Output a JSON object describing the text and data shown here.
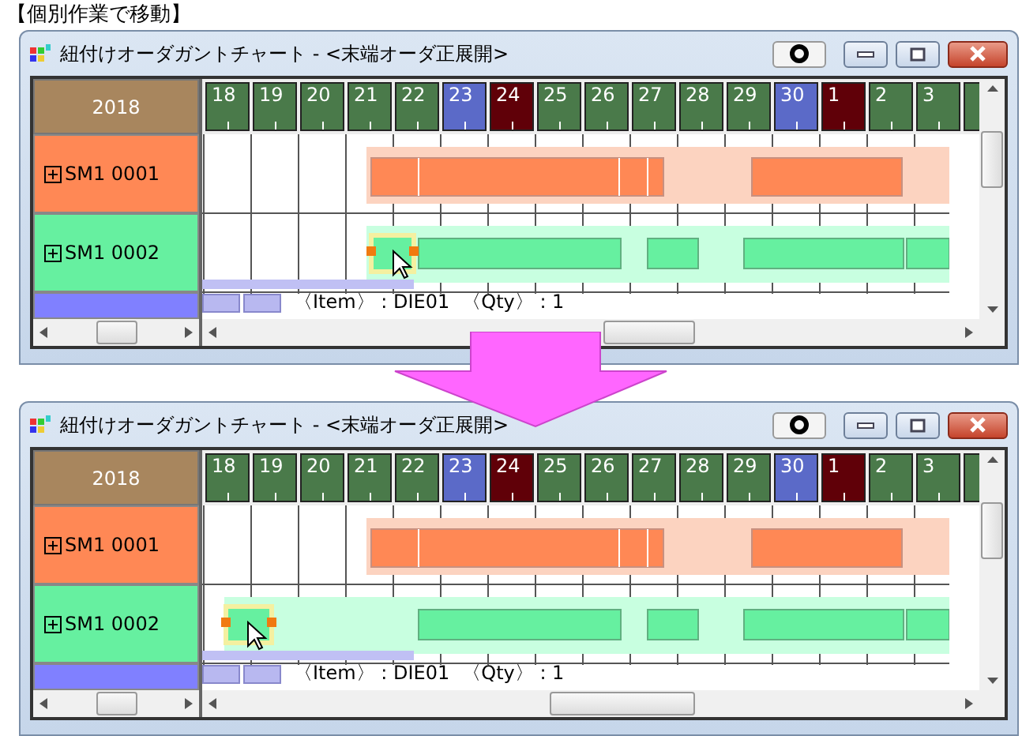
{
  "caption": "【個別作業で移動】",
  "windows": [
    {
      "kind": "before",
      "title": "紐付けオーダガントチャート - <末端オーダ正展開>",
      "year": "2018",
      "days": [
        {
          "label": "18",
          "kind": "weekday"
        },
        {
          "label": "19",
          "kind": "weekday"
        },
        {
          "label": "20",
          "kind": "weekday"
        },
        {
          "label": "21",
          "kind": "weekday"
        },
        {
          "label": "22",
          "kind": "weekday"
        },
        {
          "label": "23",
          "kind": "saturday"
        },
        {
          "label": "24",
          "kind": "sunday"
        },
        {
          "label": "25",
          "kind": "weekday"
        },
        {
          "label": "26",
          "kind": "weekday"
        },
        {
          "label": "27",
          "kind": "weekday"
        },
        {
          "label": "28",
          "kind": "weekday"
        },
        {
          "label": "29",
          "kind": "weekday"
        },
        {
          "label": "30",
          "kind": "saturday"
        },
        {
          "label": "1",
          "kind": "sunday"
        },
        {
          "label": "2",
          "kind": "weekday"
        },
        {
          "label": "3",
          "kind": "weekday"
        }
      ],
      "rows": [
        {
          "label": "SM1 0001",
          "color": "#ff8855"
        },
        {
          "label": "SM1 0002",
          "color": "#66f0a0"
        }
      ],
      "tooltip": [
        "〈Item〉 : DIE01",
        "〈Qty〉 : 1"
      ]
    },
    {
      "kind": "after",
      "title": "紐付けオーダガントチャート - <末端オーダ正展開>",
      "year": "2018",
      "days": [
        {
          "label": "18",
          "kind": "weekday"
        },
        {
          "label": "19",
          "kind": "weekday"
        },
        {
          "label": "20",
          "kind": "weekday"
        },
        {
          "label": "21",
          "kind": "weekday"
        },
        {
          "label": "22",
          "kind": "weekday"
        },
        {
          "label": "23",
          "kind": "saturday"
        },
        {
          "label": "24",
          "kind": "sunday"
        },
        {
          "label": "25",
          "kind": "weekday"
        },
        {
          "label": "26",
          "kind": "weekday"
        },
        {
          "label": "27",
          "kind": "weekday"
        },
        {
          "label": "28",
          "kind": "weekday"
        },
        {
          "label": "29",
          "kind": "weekday"
        },
        {
          "label": "30",
          "kind": "saturday"
        },
        {
          "label": "1",
          "kind": "sunday"
        },
        {
          "label": "2",
          "kind": "weekday"
        },
        {
          "label": "3",
          "kind": "weekday"
        }
      ],
      "rows": [
        {
          "label": "SM1 0001",
          "color": "#ff8855"
        },
        {
          "label": "SM1 0002",
          "color": "#66f0a0"
        }
      ],
      "tooltip": [
        "〈Item〉 : DIE01",
        "〈Qty〉 : 1"
      ]
    }
  ]
}
